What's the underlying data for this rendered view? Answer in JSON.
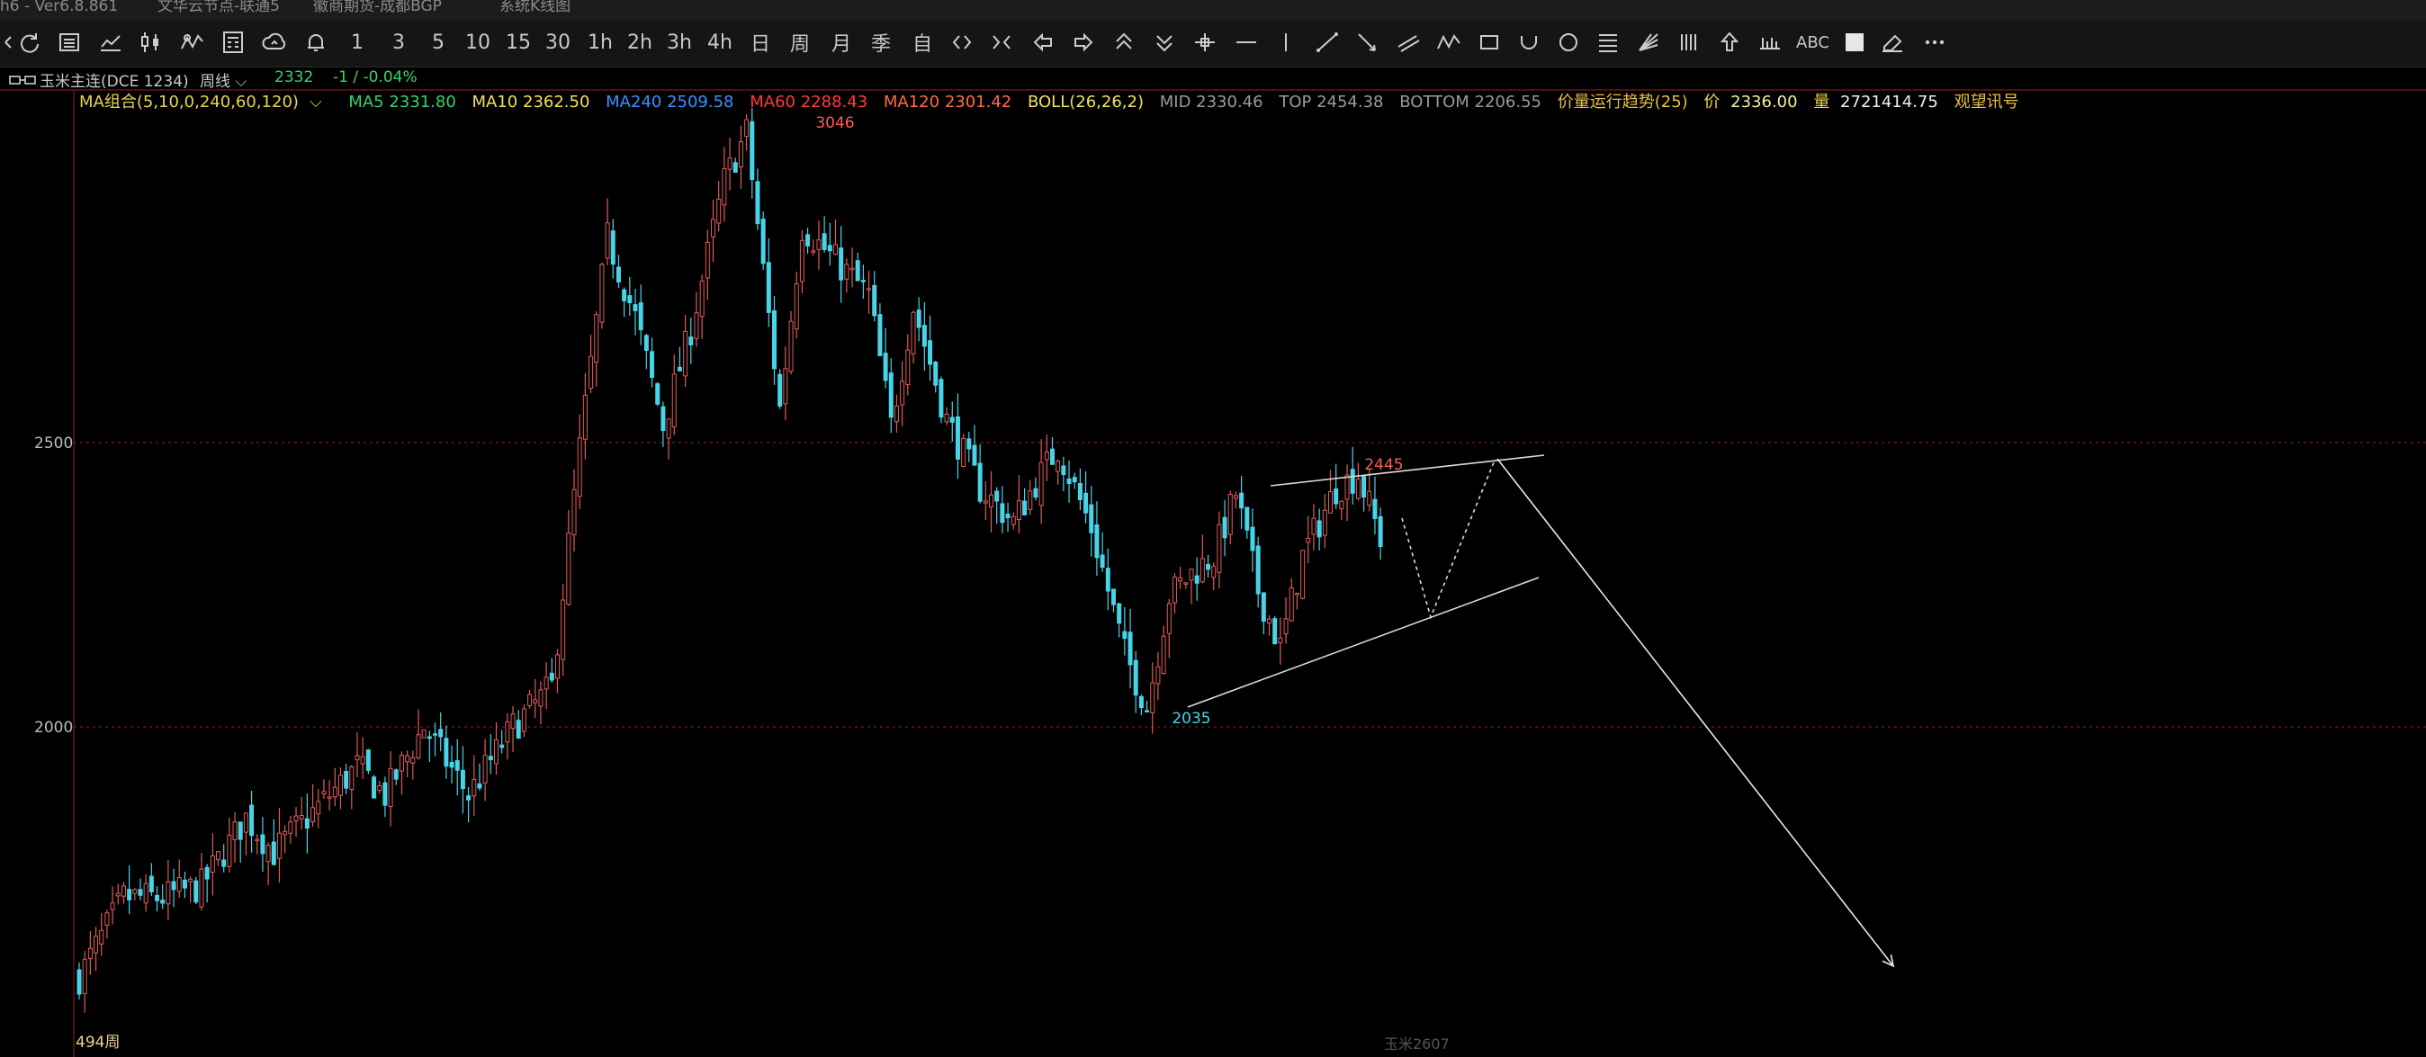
{
  "titlebar": {
    "app": "h6  -  Ver6.8.861",
    "server": "文华云节点-联通5",
    "broker": "徽商期货-成都BGP",
    "view": "系统K线图"
  },
  "toolbar": {
    "periods": [
      "1",
      "3",
      "5",
      "10",
      "15",
      "30",
      "1h",
      "2h",
      "3h",
      "4h",
      "日",
      "周",
      "月",
      "季",
      "自"
    ],
    "text_tool": "ABC"
  },
  "infobar": {
    "symbol": "玉米主连(DCE 1234)",
    "period": "周线",
    "price": "2332",
    "change": "-1 / -0.04%"
  },
  "legend": {
    "ma_group": "MA组合(5,10,0,240,60,120)",
    "ma5": "MA5 2331.80",
    "ma10": "MA10 2362.50",
    "ma240": "MA240 2509.58",
    "ma60": "MA60 2288.43",
    "ma120": "MA120 2301.42",
    "boll": "BOLL(26,26,2)",
    "mid": "MID 2330.46",
    "top": "TOP 2454.38",
    "bottom": "BOTTOM 2206.55",
    "trend": "价量运行趋势(25)",
    "price_label": "价",
    "price_value": "2336.00",
    "vol_label": "量",
    "vol_value": "2721414.75",
    "signal": "观望讯号"
  },
  "chart_data": {
    "type": "candlestick",
    "y_ticks": [
      2000,
      2500
    ],
    "annotations": {
      "high": "3046",
      "low": "2035",
      "recent_high": "2445",
      "bar_count": "494周",
      "contract": "玉米2607"
    },
    "series": {
      "weekly_close_waypoints": [
        [
          0,
          1560
        ],
        [
          8,
          1700
        ],
        [
          15,
          1700
        ],
        [
          22,
          1720
        ],
        [
          30,
          1840
        ],
        [
          35,
          1780
        ],
        [
          42,
          1850
        ],
        [
          50,
          1930
        ],
        [
          55,
          1880
        ],
        [
          62,
          2000
        ],
        [
          70,
          1880
        ],
        [
          78,
          2000
        ],
        [
          85,
          2070
        ],
        [
          90,
          2490
        ],
        [
          95,
          2860
        ],
        [
          100,
          2720
        ],
        [
          105,
          2530
        ],
        [
          110,
          2700
        ],
        [
          116,
          2960
        ],
        [
          120,
          3046
        ],
        [
          126,
          2560
        ],
        [
          130,
          2880
        ],
        [
          136,
          2820
        ],
        [
          142,
          2760
        ],
        [
          146,
          2530
        ],
        [
          150,
          2740
        ],
        [
          156,
          2540
        ],
        [
          162,
          2420
        ],
        [
          168,
          2360
        ],
        [
          172,
          2430
        ],
        [
          176,
          2490
        ],
        [
          182,
          2350
        ],
        [
          188,
          2130
        ],
        [
          192,
          2035
        ],
        [
          196,
          2230
        ],
        [
          200,
          2270
        ],
        [
          204,
          2300
        ],
        [
          208,
          2410
        ],
        [
          212,
          2240
        ],
        [
          216,
          2140
        ],
        [
          220,
          2300
        ],
        [
          226,
          2420
        ],
        [
          230,
          2445
        ],
        [
          234,
          2332
        ]
      ]
    },
    "drawings": {
      "channel_upper": [
        [
          2035,
          2420
        ],
        [
          2445,
          2470
        ]
      ],
      "channel_lower": [
        [
          2035,
          2040
        ],
        [
          2445,
          2270
        ]
      ]
    },
    "colors": {
      "up": "#e05b5b",
      "down": "#48d4e8",
      "grid": "#7a1a1a",
      "high_label": "#ff5a5a",
      "low_label": "#48d4e8"
    }
  }
}
